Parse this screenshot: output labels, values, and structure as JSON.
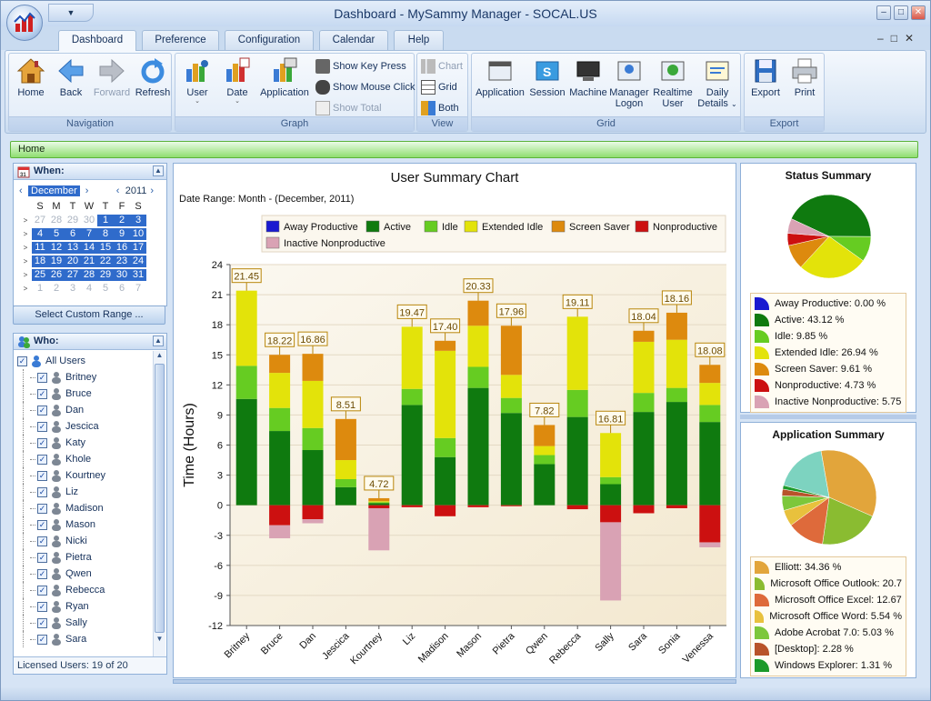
{
  "window": {
    "title": "Dashboard - MySammy Manager - SOCAL.US"
  },
  "tabs": [
    {
      "label": "Dashboard",
      "active": true
    },
    {
      "label": "Preference",
      "active": false
    },
    {
      "label": "Configuration",
      "active": false
    },
    {
      "label": "Calendar",
      "active": false
    },
    {
      "label": "Help",
      "active": false
    }
  ],
  "ribbon": {
    "navigation": {
      "label": "Navigation",
      "home": "Home",
      "back": "Back",
      "forward": "Forward",
      "refresh": "Refresh"
    },
    "graph": {
      "label": "Graph",
      "user": "User",
      "date": "Date",
      "application": "Application",
      "show_key_press": "Show Key Press",
      "show_mouse_click": "Show Mouse Click",
      "show_total": "Show Total"
    },
    "view": {
      "label": "View",
      "chart": "Chart",
      "grid": "Grid",
      "both": "Both"
    },
    "grid": {
      "label": "Grid",
      "application": "Application",
      "session": "Session",
      "machine": "Machine",
      "manager_logon_1": "Manager",
      "manager_logon_2": "Logon",
      "realtime_user_1": "Realtime",
      "realtime_user_2": "User",
      "daily_details_1": "Daily",
      "daily_details_2": "Details"
    },
    "export": {
      "label": "Export",
      "export": "Export",
      "print": "Print"
    }
  },
  "breadcrumb": "Home",
  "when": {
    "header": "When:",
    "month": "December",
    "year": "2011",
    "day_headers": [
      "S",
      "M",
      "T",
      "W",
      "T",
      "F",
      "S"
    ],
    "weeks": [
      {
        "marker": ">",
        "days": [
          "27",
          "28",
          "29",
          "30",
          "1",
          "2",
          "3"
        ]
      },
      {
        "marker": ">",
        "days": [
          "4",
          "5",
          "6",
          "7",
          "8",
          "9",
          "10"
        ]
      },
      {
        "marker": ">",
        "days": [
          "11",
          "12",
          "13",
          "14",
          "15",
          "16",
          "17"
        ]
      },
      {
        "marker": ">",
        "days": [
          "18",
          "19",
          "20",
          "21",
          "22",
          "23",
          "24"
        ]
      },
      {
        "marker": ">",
        "days": [
          "25",
          "26",
          "27",
          "28",
          "29",
          "30",
          "31"
        ]
      },
      {
        "marker": ">",
        "days": [
          "1",
          "2",
          "3",
          "4",
          "5",
          "6",
          "7"
        ]
      }
    ],
    "custom_range": "Select Custom Range ..."
  },
  "who": {
    "header": "Who:",
    "all_users": "All Users",
    "users": [
      "Britney",
      "Bruce",
      "Dan",
      "Jescica",
      "Katy",
      "Khole",
      "Kourtney",
      "Liz",
      "Madison",
      "Mason",
      "Nicki",
      "Pietra",
      "Qwen",
      "Rebecca",
      "Ryan",
      "Sally",
      "Sara"
    ],
    "licensed": "Licensed Users: 19 of 20"
  },
  "colors": {
    "away_productive": "#1a1ad0",
    "active": "#0f7a0f",
    "idle": "#66cc22",
    "extended_idle": "#e3e30a",
    "screen_saver": "#dd8a0e",
    "nonproductive": "#cc1010",
    "inactive_nonproductive": "#d9a2b4"
  },
  "chart_data": {
    "type": "bar",
    "title": "User Summary Chart",
    "subtitle": "Date Range: Month - (December, 2011)",
    "ylabel": "Time (Hours)",
    "ylim": [
      -12,
      24
    ],
    "yticks": [
      24,
      21,
      18,
      15,
      12,
      9,
      6,
      3,
      0,
      -3,
      -6,
      -9,
      -12
    ],
    "categories": [
      "Britney",
      "Bruce",
      "Dan",
      "Jescica",
      "Kourtney",
      "Liz",
      "Madison",
      "Mason",
      "Pietra",
      "Qwen",
      "Rebecca",
      "Sally",
      "Sara",
      "Sonia",
      "Venessa"
    ],
    "totals": [
      "21.45",
      "18.22",
      "16.86",
      "8.51",
      "4.72",
      "19.47",
      "17.40",
      "20.33",
      "17.96",
      "7.82",
      "19.11",
      "16.81",
      "18.04",
      "18.16",
      "18.08"
    ],
    "series": [
      {
        "name": "Away Productive",
        "values": [
          0,
          0,
          0,
          0,
          0,
          0,
          0,
          0,
          0,
          0,
          0,
          0,
          0,
          0,
          0
        ]
      },
      {
        "name": "Active",
        "values": [
          10.6,
          7.4,
          5.5,
          1.8,
          0.2,
          10,
          4.8,
          11.7,
          9.2,
          4.1,
          8.8,
          2.1,
          9.3,
          10.3,
          8.3
        ]
      },
      {
        "name": "Idle",
        "values": [
          3.3,
          2.3,
          2.2,
          0.8,
          0.1,
          1.6,
          1.9,
          2.1,
          1.5,
          0.9,
          2.7,
          0.7,
          1.9,
          1.4,
          1.7
        ]
      },
      {
        "name": "Extended Idle",
        "values": [
          7.5,
          3.5,
          4.7,
          1.9,
          0.1,
          6.2,
          8.7,
          4.1,
          2.3,
          0.9,
          7.3,
          4.4,
          5.1,
          4.8,
          2.2
        ]
      },
      {
        "name": "Screen Saver",
        "values": [
          0,
          1.8,
          2.7,
          4.1,
          0.3,
          0,
          1,
          2.5,
          4.9,
          2.1,
          0,
          0,
          1.1,
          2.7,
          1.8
        ]
      },
      {
        "name": "Nonproductive",
        "values": [
          0,
          -2,
          -1.4,
          0,
          -0.3,
          -0.2,
          -1.1,
          -0.2,
          -0.1,
          0,
          -0.4,
          -1.7,
          -0.8,
          -0.3,
          -3.7
        ]
      },
      {
        "name": "Inactive Nonproductive",
        "values": [
          0,
          -1.3,
          -0.4,
          0,
          -4.2,
          0,
          0,
          0,
          0,
          0,
          0,
          -7.8,
          0,
          0,
          -0.5
        ]
      }
    ],
    "legend": [
      "Away Productive",
      "Active",
      "Idle",
      "Extended Idle",
      "Screen Saver",
      "Nonproductive",
      "Inactive Nonproductive"
    ],
    "grid": true
  },
  "status_summary": {
    "title": "Status Summary",
    "legend": [
      {
        "label": "Away Productive: 0.00 %",
        "value": 0.0,
        "color": "#1a1ad0"
      },
      {
        "label": "Active: 43.12 %",
        "value": 43.12,
        "color": "#0f7a0f"
      },
      {
        "label": "Idle: 9.85 %",
        "value": 9.85,
        "color": "#66cc22"
      },
      {
        "label": "Extended Idle: 26.94 %",
        "value": 26.94,
        "color": "#e3e30a"
      },
      {
        "label": "Screen Saver: 9.61 %",
        "value": 9.61,
        "color": "#dd8a0e"
      },
      {
        "label": "Nonproductive: 4.73 %",
        "value": 4.73,
        "color": "#cc1010"
      },
      {
        "label": "Inactive Nonproductive: 5.75",
        "value": 5.75,
        "color": "#d9a2b4"
      }
    ]
  },
  "application_summary": {
    "title": "Application Summary",
    "legend": [
      {
        "label": "Elliott: 34.36 %",
        "value": 34.36,
        "color": "#e2a53b"
      },
      {
        "label": "Microsoft Office Outlook: 20.7",
        "value": 20.7,
        "color": "#8abc31"
      },
      {
        "label": "Microsoft Office Excel: 12.67 ",
        "value": 12.67,
        "color": "#de6a3b"
      },
      {
        "label": "Microsoft Office Word: 5.54 %",
        "value": 5.54,
        "color": "#e8c13d"
      },
      {
        "label": "Adobe Acrobat 7.0: 5.03 %",
        "value": 5.03,
        "color": "#7cc73b"
      },
      {
        "label": "[Desktop]: 2.28 %",
        "value": 2.28,
        "color": "#b8532a"
      },
      {
        "label": "Windows Explorer: 1.31 %",
        "value": 1.31,
        "color": "#1c9a2a"
      }
    ]
  }
}
